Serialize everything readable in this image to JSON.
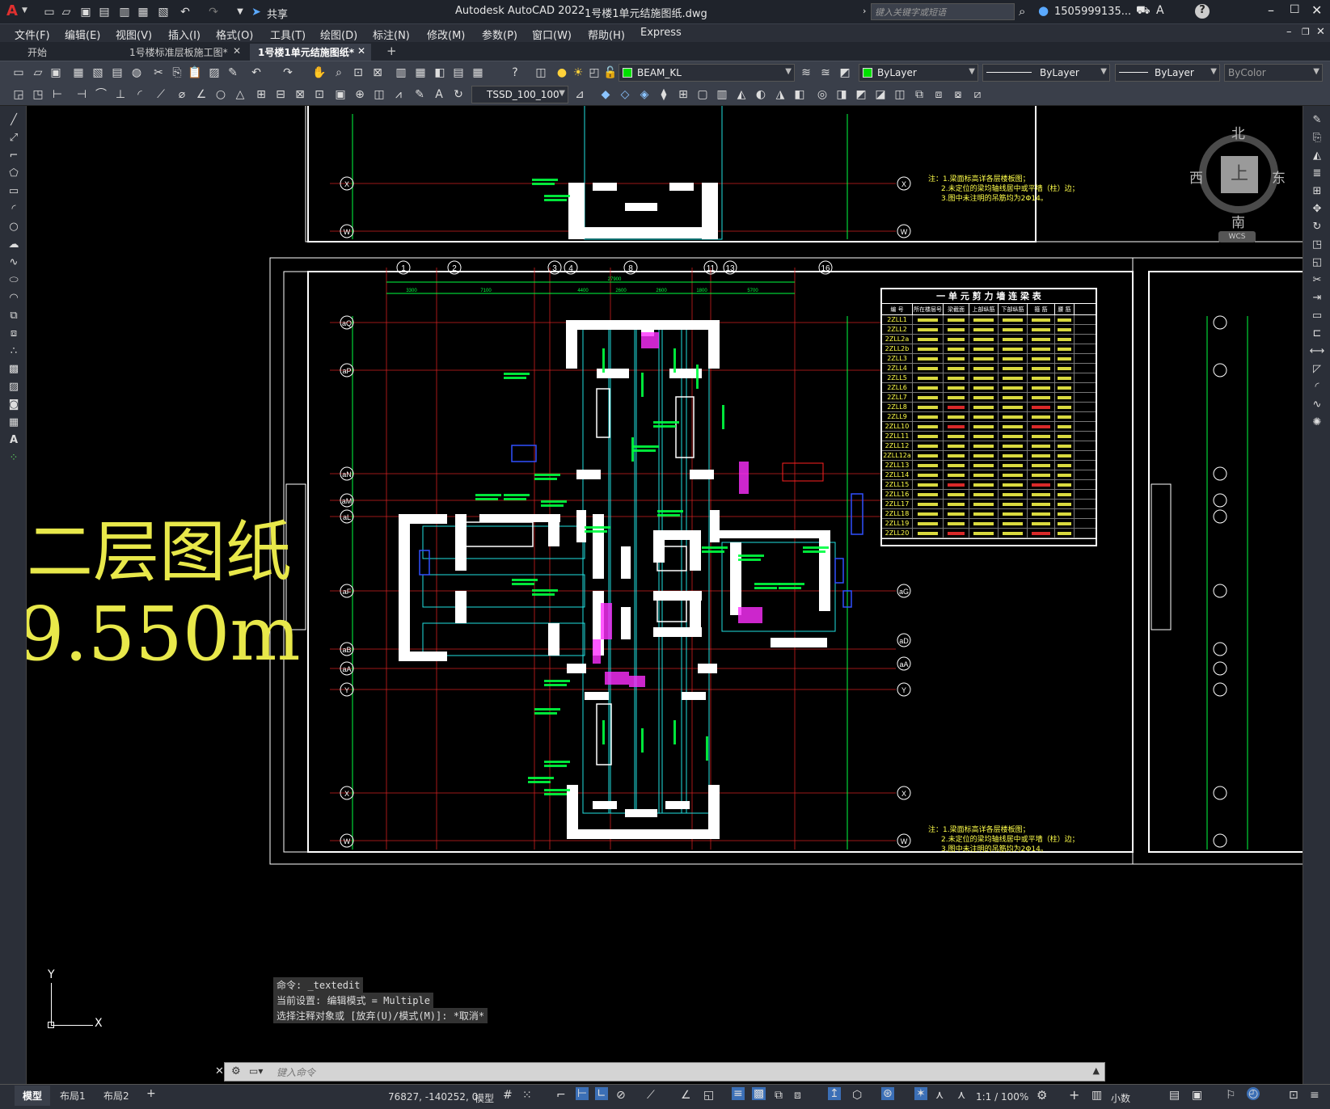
{
  "titlebar": {
    "logo": "A",
    "share_label": "共享",
    "app_title": "Autodesk AutoCAD 2022",
    "file_title": "1号楼1单元结施图纸.dwg",
    "search_placeholder": "键入关键字或短语",
    "user": "1505999135...",
    "help": "?"
  },
  "menu": [
    "文件(F)",
    "编辑(E)",
    "视图(V)",
    "插入(I)",
    "格式(O)",
    "工具(T)",
    "绘图(D)",
    "标注(N)",
    "修改(M)",
    "参数(P)",
    "窗口(W)",
    "帮助(H)",
    "Express"
  ],
  "tabs": [
    {
      "label": "开始"
    },
    {
      "label": "1号楼标准层板施工图*"
    },
    {
      "label": "1号楼1单元结施图纸*"
    }
  ],
  "toolbar": {
    "layer": "BEAM_KL",
    "color": "ByLayer",
    "linetype": "ByLayer",
    "lineweight": "ByLayer",
    "plotstyle": "ByColor",
    "textstyle": "TSSD_100_100"
  },
  "viewcube": {
    "north": "北",
    "south": "南",
    "east": "东",
    "west": "西",
    "top": "上",
    "wcs": "WCS"
  },
  "drawing": {
    "big_text_1": "二层图纸",
    "big_text_2": "9.550m",
    "table_title": "一 单 元 剪 力 墙 连 梁 表",
    "table_headers": [
      "编 号",
      "所在楼层号",
      "梁截面",
      "上部纵筋",
      "下部纵筋",
      "箍 筋",
      "腰 筋"
    ],
    "table_rows": [
      "2ZLL1",
      "2ZLL2",
      "2ZLL2a",
      "2ZLL2b",
      "2ZLL3",
      "2ZLL4",
      "2ZLL5",
      "2ZLL6",
      "2ZLL7",
      "2ZLL8",
      "2ZLL9",
      "2ZLL10",
      "2ZLL11",
      "2ZLL12",
      "2ZLL12a",
      "2ZLL13",
      "2ZLL14",
      "2ZLL15",
      "2ZLL16",
      "2ZLL17",
      "2ZLL18",
      "2ZLL19",
      "2ZLL20"
    ],
    "notes": [
      "注：1.梁面标高详各层楼板图；",
      "2.未定位的梁均轴线居中或平墙（柱）边；",
      "3.图中未注明的吊筋均为2Φ14。"
    ],
    "axis_top": [
      "1",
      "2",
      "3",
      "4",
      "8",
      "11",
      "13",
      "16"
    ],
    "axis_left": [
      "X",
      "W",
      "aQ",
      "aP",
      "aN",
      "aM",
      "aL",
      "aF",
      "aB",
      "aA",
      "Y",
      "X",
      "W"
    ],
    "axis_right": [
      "X",
      "W",
      "aK",
      "aG",
      "aD",
      "aA",
      "Y",
      "X",
      "W"
    ],
    "dims_top": [
      "3300",
      "7100",
      "4400",
      "2600",
      "2600",
      "1800",
      "5700"
    ],
    "dim_total": "27900"
  },
  "command": {
    "line1": "命令: _textedit",
    "line2": "当前设置: 编辑模式 = Multiple",
    "line3": "选择注释对象或 [放弃(U)/模式(M)]: *取消*",
    "input_placeholder": "键入命令"
  },
  "ucs": {
    "x": "X",
    "y": "Y"
  },
  "status": {
    "tabs": [
      "模型",
      "布局1",
      "布局2"
    ],
    "coords": "76827, -140252, 0",
    "model": "模型",
    "scale": "1:1 / 100%",
    "units": "小数"
  }
}
